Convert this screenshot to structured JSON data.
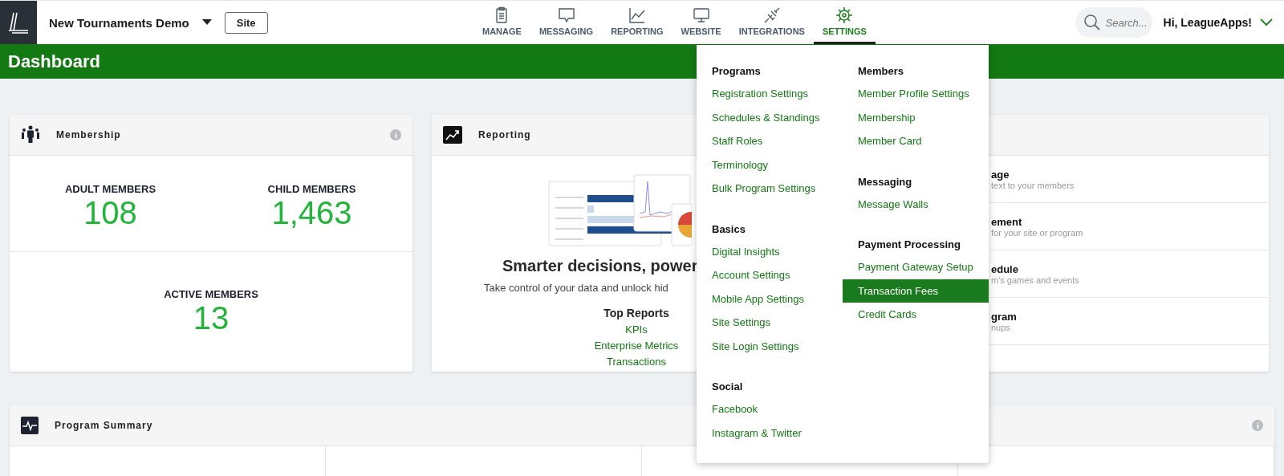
{
  "header": {
    "org_name": "New Tournaments Demo",
    "site_button": "Site"
  },
  "nav": [
    {
      "label": "MANAGE",
      "selected": false
    },
    {
      "label": "MESSAGING",
      "selected": false
    },
    {
      "label": "REPORTING",
      "selected": false
    },
    {
      "label": "WEBSITE",
      "selected": false
    },
    {
      "label": "INTEGRATIONS",
      "selected": false
    },
    {
      "label": "SETTINGS",
      "selected": true
    }
  ],
  "search": {
    "placeholder": "Search..."
  },
  "user_menu": {
    "label": "Hi, LeagueApps!"
  },
  "page_title": "Dashboard",
  "settings_menu": {
    "columns": [
      {
        "sections": [
          {
            "heading": "Programs",
            "items": [
              {
                "label": "Registration Settings",
                "selected": false
              },
              {
                "label": "Schedules & Standings",
                "selected": false
              },
              {
                "label": "Staff Roles",
                "selected": false
              },
              {
                "label": "Terminology",
                "selected": false
              },
              {
                "label": "Bulk Program Settings",
                "selected": false
              }
            ]
          },
          {
            "heading": "Basics",
            "items": [
              {
                "label": "Digital Insights",
                "selected": false
              },
              {
                "label": "Account Settings",
                "selected": false
              },
              {
                "label": "Mobile App Settings",
                "selected": false
              },
              {
                "label": "Site Settings",
                "selected": false
              },
              {
                "label": "Site Login Settings",
                "selected": false
              }
            ]
          },
          {
            "heading": "Social",
            "items": [
              {
                "label": "Facebook",
                "selected": false
              },
              {
                "label": "Instagram & Twitter",
                "selected": false
              }
            ]
          }
        ]
      },
      {
        "sections": [
          {
            "heading": "Members",
            "items": [
              {
                "label": "Member Profile Settings",
                "selected": false
              },
              {
                "label": "Membership",
                "selected": false
              },
              {
                "label": "Member Card",
                "selected": false
              }
            ]
          },
          {
            "heading": "Messaging",
            "items": [
              {
                "label": "Message Walls",
                "selected": false
              }
            ]
          },
          {
            "heading": "Payment Processing",
            "items": [
              {
                "label": "Payment Gateway Setup",
                "selected": false
              },
              {
                "label": "Transaction Fees",
                "selected": true
              },
              {
                "label": "Credit Cards",
                "selected": false
              }
            ]
          }
        ]
      }
    ]
  },
  "membership_card": {
    "title": "Membership",
    "stats": [
      {
        "label": "ADULT MEMBERS",
        "value": "108"
      },
      {
        "label": "CHILD MEMBERS",
        "value": "1,463"
      },
      {
        "label": "ACTIVE MEMBERS",
        "value": "13"
      }
    ]
  },
  "reporting_card": {
    "title": "Reporting",
    "headline": "Smarter decisions, power",
    "subtitle": "Take control of your data and unlock hid",
    "top_reports_heading": "Top Reports",
    "links": [
      "KPIs",
      "Enterprise Metrics",
      "Transactions"
    ]
  },
  "quick_actions": [
    {
      "title": "age",
      "description": "text to your members"
    },
    {
      "title": "ement",
      "description": "for your site or program"
    },
    {
      "title": "edule",
      "description": "m's games and events"
    },
    {
      "title": "gram",
      "description": "nups"
    }
  ],
  "program_summary": {
    "title": "Program Summary"
  }
}
